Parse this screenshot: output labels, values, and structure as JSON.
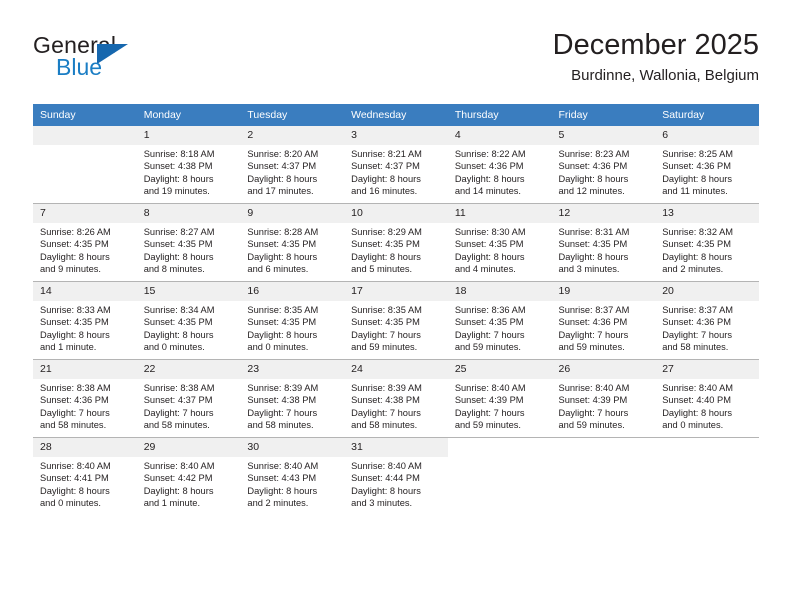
{
  "brand": {
    "name_part1": "General",
    "name_part2": "Blue",
    "logo_icon": "triangle-logo-icon"
  },
  "header": {
    "title": "December 2025",
    "subtitle": "Burdinne, Wallonia, Belgium"
  },
  "calendar": {
    "weekday_headers": [
      "Sunday",
      "Monday",
      "Tuesday",
      "Wednesday",
      "Thursday",
      "Friday",
      "Saturday"
    ],
    "accent_color": "#3a7dbf",
    "daynum_bg_color": "#f0f0f0",
    "grid_line_color": "#b4b4b4",
    "weeks": [
      [
        {
          "day": "",
          "lines": []
        },
        {
          "day": "1",
          "lines": [
            "Sunrise: 8:18 AM",
            "Sunset: 4:38 PM",
            "Daylight: 8 hours",
            "and 19 minutes."
          ]
        },
        {
          "day": "2",
          "lines": [
            "Sunrise: 8:20 AM",
            "Sunset: 4:37 PM",
            "Daylight: 8 hours",
            "and 17 minutes."
          ]
        },
        {
          "day": "3",
          "lines": [
            "Sunrise: 8:21 AM",
            "Sunset: 4:37 PM",
            "Daylight: 8 hours",
            "and 16 minutes."
          ]
        },
        {
          "day": "4",
          "lines": [
            "Sunrise: 8:22 AM",
            "Sunset: 4:36 PM",
            "Daylight: 8 hours",
            "and 14 minutes."
          ]
        },
        {
          "day": "5",
          "lines": [
            "Sunrise: 8:23 AM",
            "Sunset: 4:36 PM",
            "Daylight: 8 hours",
            "and 12 minutes."
          ]
        },
        {
          "day": "6",
          "lines": [
            "Sunrise: 8:25 AM",
            "Sunset: 4:36 PM",
            "Daylight: 8 hours",
            "and 11 minutes."
          ]
        }
      ],
      [
        {
          "day": "7",
          "lines": [
            "Sunrise: 8:26 AM",
            "Sunset: 4:35 PM",
            "Daylight: 8 hours",
            "and 9 minutes."
          ]
        },
        {
          "day": "8",
          "lines": [
            "Sunrise: 8:27 AM",
            "Sunset: 4:35 PM",
            "Daylight: 8 hours",
            "and 8 minutes."
          ]
        },
        {
          "day": "9",
          "lines": [
            "Sunrise: 8:28 AM",
            "Sunset: 4:35 PM",
            "Daylight: 8 hours",
            "and 6 minutes."
          ]
        },
        {
          "day": "10",
          "lines": [
            "Sunrise: 8:29 AM",
            "Sunset: 4:35 PM",
            "Daylight: 8 hours",
            "and 5 minutes."
          ]
        },
        {
          "day": "11",
          "lines": [
            "Sunrise: 8:30 AM",
            "Sunset: 4:35 PM",
            "Daylight: 8 hours",
            "and 4 minutes."
          ]
        },
        {
          "day": "12",
          "lines": [
            "Sunrise: 8:31 AM",
            "Sunset: 4:35 PM",
            "Daylight: 8 hours",
            "and 3 minutes."
          ]
        },
        {
          "day": "13",
          "lines": [
            "Sunrise: 8:32 AM",
            "Sunset: 4:35 PM",
            "Daylight: 8 hours",
            "and 2 minutes."
          ]
        }
      ],
      [
        {
          "day": "14",
          "lines": [
            "Sunrise: 8:33 AM",
            "Sunset: 4:35 PM",
            "Daylight: 8 hours",
            "and 1 minute."
          ]
        },
        {
          "day": "15",
          "lines": [
            "Sunrise: 8:34 AM",
            "Sunset: 4:35 PM",
            "Daylight: 8 hours",
            "and 0 minutes."
          ]
        },
        {
          "day": "16",
          "lines": [
            "Sunrise: 8:35 AM",
            "Sunset: 4:35 PM",
            "Daylight: 8 hours",
            "and 0 minutes."
          ]
        },
        {
          "day": "17",
          "lines": [
            "Sunrise: 8:35 AM",
            "Sunset: 4:35 PM",
            "Daylight: 7 hours",
            "and 59 minutes."
          ]
        },
        {
          "day": "18",
          "lines": [
            "Sunrise: 8:36 AM",
            "Sunset: 4:35 PM",
            "Daylight: 7 hours",
            "and 59 minutes."
          ]
        },
        {
          "day": "19",
          "lines": [
            "Sunrise: 8:37 AM",
            "Sunset: 4:36 PM",
            "Daylight: 7 hours",
            "and 59 minutes."
          ]
        },
        {
          "day": "20",
          "lines": [
            "Sunrise: 8:37 AM",
            "Sunset: 4:36 PM",
            "Daylight: 7 hours",
            "and 58 minutes."
          ]
        }
      ],
      [
        {
          "day": "21",
          "lines": [
            "Sunrise: 8:38 AM",
            "Sunset: 4:36 PM",
            "Daylight: 7 hours",
            "and 58 minutes."
          ]
        },
        {
          "day": "22",
          "lines": [
            "Sunrise: 8:38 AM",
            "Sunset: 4:37 PM",
            "Daylight: 7 hours",
            "and 58 minutes."
          ]
        },
        {
          "day": "23",
          "lines": [
            "Sunrise: 8:39 AM",
            "Sunset: 4:38 PM",
            "Daylight: 7 hours",
            "and 58 minutes."
          ]
        },
        {
          "day": "24",
          "lines": [
            "Sunrise: 8:39 AM",
            "Sunset: 4:38 PM",
            "Daylight: 7 hours",
            "and 58 minutes."
          ]
        },
        {
          "day": "25",
          "lines": [
            "Sunrise: 8:40 AM",
            "Sunset: 4:39 PM",
            "Daylight: 7 hours",
            "and 59 minutes."
          ]
        },
        {
          "day": "26",
          "lines": [
            "Sunrise: 8:40 AM",
            "Sunset: 4:39 PM",
            "Daylight: 7 hours",
            "and 59 minutes."
          ]
        },
        {
          "day": "27",
          "lines": [
            "Sunrise: 8:40 AM",
            "Sunset: 4:40 PM",
            "Daylight: 8 hours",
            "and 0 minutes."
          ]
        }
      ],
      [
        {
          "day": "28",
          "lines": [
            "Sunrise: 8:40 AM",
            "Sunset: 4:41 PM",
            "Daylight: 8 hours",
            "and 0 minutes."
          ]
        },
        {
          "day": "29",
          "lines": [
            "Sunrise: 8:40 AM",
            "Sunset: 4:42 PM",
            "Daylight: 8 hours",
            "and 1 minute."
          ]
        },
        {
          "day": "30",
          "lines": [
            "Sunrise: 8:40 AM",
            "Sunset: 4:43 PM",
            "Daylight: 8 hours",
            "and 2 minutes."
          ]
        },
        {
          "day": "31",
          "lines": [
            "Sunrise: 8:40 AM",
            "Sunset: 4:44 PM",
            "Daylight: 8 hours",
            "and 3 minutes."
          ]
        },
        {
          "day": "",
          "lines": []
        },
        {
          "day": "",
          "lines": []
        },
        {
          "day": "",
          "lines": []
        }
      ]
    ]
  }
}
